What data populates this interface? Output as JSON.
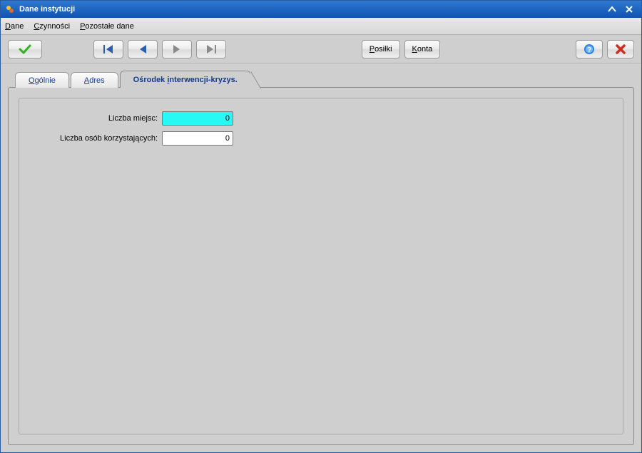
{
  "window": {
    "title": "Dane instytucji"
  },
  "menubar": {
    "items": [
      {
        "label": "Dane",
        "mn": "D",
        "rest": "ane"
      },
      {
        "label": "Czynności",
        "mn": "C",
        "rest": "zynności"
      },
      {
        "label": "Pozostałe dane",
        "mn": "P",
        "rest": "ozostałe dane"
      }
    ]
  },
  "toolbar": {
    "confirm_icon": "check",
    "nav_first_icon": "nav-first",
    "nav_prev_icon": "nav-prev",
    "nav_next_icon": "nav-next",
    "nav_last_icon": "nav-last",
    "posilki_mn": "P",
    "posilki_rest": "osiłki",
    "konta_mn": "K",
    "konta_rest": "onta",
    "help_icon": "help",
    "close_icon": "close-x"
  },
  "tabs": [
    {
      "mn": "O",
      "rest": "gólnie",
      "active": false
    },
    {
      "mn": "A",
      "rest": "dres",
      "active": false
    },
    {
      "pre": "Ośrodek ",
      "mn": "i",
      "rest": "nterwencji-kryzys.",
      "active": true
    }
  ],
  "form": {
    "liczba_miejsc_label": "Liczba miejsc:",
    "liczba_miejsc_value": "0",
    "liczba_osob_label": "Liczba osób korzystających:",
    "liczba_osob_value": "0"
  },
  "colors": {
    "title_bg_top": "#2f79d1",
    "title_bg_bottom": "#0f53b0",
    "panel_bg": "#cfcfcf",
    "tab_text": "#153a8a",
    "focus_field_bg": "#28f8f6",
    "confirm_green": "#2fb31e",
    "close_red": "#d22b1f",
    "nav_blue": "#2a5fb0",
    "help_blue": "#2a7fe0"
  }
}
